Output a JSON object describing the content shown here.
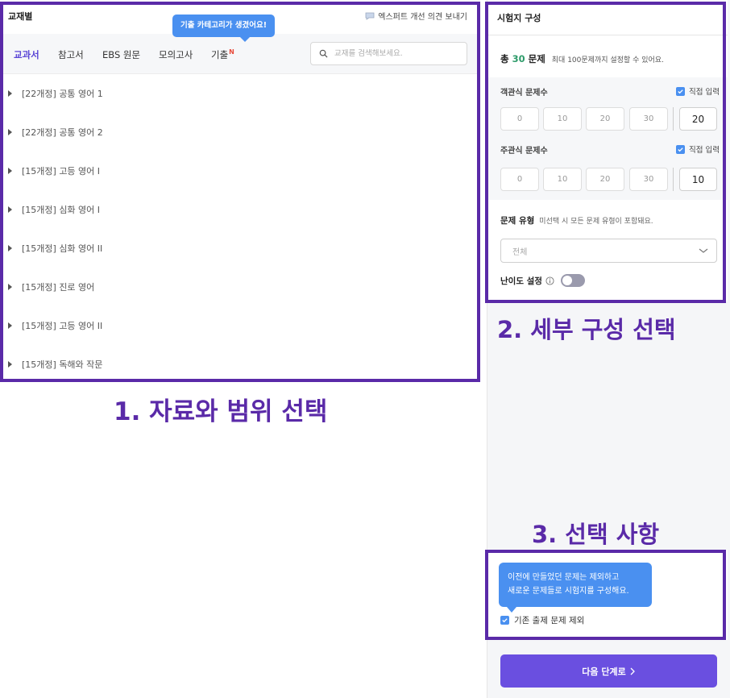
{
  "left": {
    "title": "교재별",
    "feedback": "엑스퍼트 개선 의견 보내기",
    "tooltip": "기출 카테고리가 생겼어요!",
    "tabs": [
      {
        "label": "교과서",
        "active": true
      },
      {
        "label": "참고서"
      },
      {
        "label": "EBS 원문"
      },
      {
        "label": "모의고사"
      },
      {
        "label": "기출",
        "badge": "N"
      }
    ],
    "search_placeholder": "교재를 검색해보세요.",
    "books": [
      "[22개정] 공통 영어 1",
      "[22개정] 공통 영어 2",
      "[15개정] 고등 영어 I",
      "[15개정] 심화 영어 I",
      "[15개정] 심화 영어 II",
      "[15개정] 진로 영어",
      "[15개정] 고등 영어 II",
      "[15개정] 독해와 작문"
    ]
  },
  "captions": {
    "one": "1. 자료와 범위 선택",
    "two": "2. 세부 구성 선택",
    "three": "3. 선택 사항"
  },
  "right": {
    "title": "시험지 구성",
    "total_prefix": "총",
    "total_count": "30",
    "total_suffix": "문제",
    "total_hint": "최대 100문제까지 설정할 수 있어요.",
    "objective": {
      "label": "객관식 문제수",
      "direct": "직접 입력",
      "presets": [
        "0",
        "10",
        "20",
        "30"
      ],
      "value": "20"
    },
    "subjective": {
      "label": "주관식 문제수",
      "direct": "직접 입력",
      "presets": [
        "0",
        "10",
        "20",
        "30"
      ],
      "value": "10"
    },
    "type_title": "문제 유형",
    "type_hint": "미선택 시 모든 문제 유형이 포함돼요.",
    "type_value": "전체",
    "difficulty": "난이도 설정",
    "difficulty_on": false,
    "tip": [
      "이전에 만들었던 문제는 제외하고",
      "새로운 문제들로 시험지를 구성해요."
    ],
    "exclude": "기존 출제 문제 제외",
    "next": "다음 단계로",
    "colors": {
      "accent": "#6a4fe0",
      "tooltip": "#4a90f0",
      "highlight": "#5a2aa8",
      "count": "#2e9b6a"
    }
  }
}
